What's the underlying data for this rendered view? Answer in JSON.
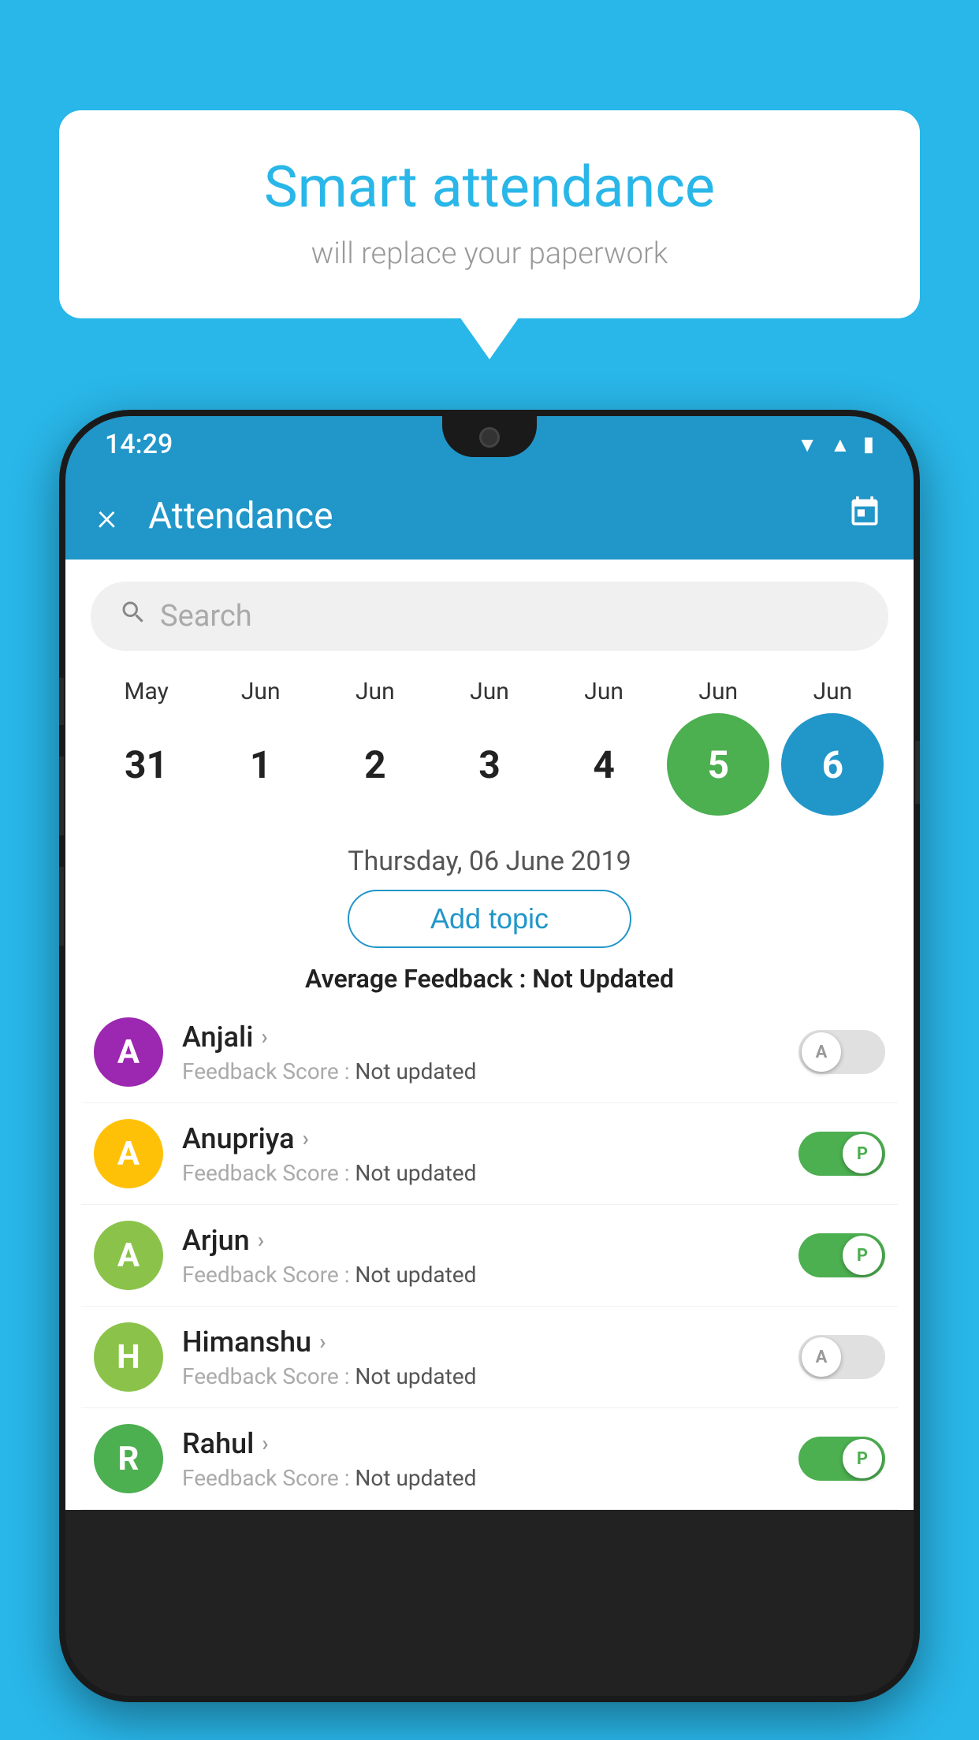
{
  "background_color": "#29b6e8",
  "speech_bubble": {
    "title": "Smart attendance",
    "subtitle": "will replace your paperwork"
  },
  "status_bar": {
    "time": "14:29",
    "icons": [
      "wifi",
      "signal",
      "battery"
    ]
  },
  "app_bar": {
    "close_label": "×",
    "title": "Attendance",
    "calendar_icon": "📅"
  },
  "search": {
    "placeholder": "Search"
  },
  "calendar": {
    "months": [
      "May",
      "Jun",
      "Jun",
      "Jun",
      "Jun",
      "Jun",
      "Jun"
    ],
    "dates": [
      {
        "date": "31",
        "state": "normal"
      },
      {
        "date": "1",
        "state": "normal"
      },
      {
        "date": "2",
        "state": "normal"
      },
      {
        "date": "3",
        "state": "normal"
      },
      {
        "date": "4",
        "state": "normal"
      },
      {
        "date": "5",
        "state": "today"
      },
      {
        "date": "6",
        "state": "selected"
      }
    ]
  },
  "selected_date": "Thursday, 06 June 2019",
  "add_topic_label": "Add topic",
  "avg_feedback_label": "Average Feedback :",
  "avg_feedback_value": "Not Updated",
  "students": [
    {
      "name": "Anjali",
      "avatar_letter": "A",
      "avatar_color": "#9c27b0",
      "feedback_label": "Feedback Score :",
      "feedback_value": "Not updated",
      "toggle_state": "off",
      "toggle_letter": "A"
    },
    {
      "name": "Anupriya",
      "avatar_letter": "A",
      "avatar_color": "#ffc107",
      "feedback_label": "Feedback Score :",
      "feedback_value": "Not updated",
      "toggle_state": "on",
      "toggle_letter": "P"
    },
    {
      "name": "Arjun",
      "avatar_letter": "A",
      "avatar_color": "#8bc34a",
      "feedback_label": "Feedback Score :",
      "feedback_value": "Not updated",
      "toggle_state": "on",
      "toggle_letter": "P"
    },
    {
      "name": "Himanshu",
      "avatar_letter": "H",
      "avatar_color": "#8bc34a",
      "feedback_label": "Feedback Score :",
      "feedback_value": "Not updated",
      "toggle_state": "off",
      "toggle_letter": "A"
    },
    {
      "name": "Rahul",
      "avatar_letter": "R",
      "avatar_color": "#4caf50",
      "feedback_label": "Feedback Score :",
      "feedback_value": "Not updated",
      "toggle_state": "on",
      "toggle_letter": "P"
    }
  ]
}
